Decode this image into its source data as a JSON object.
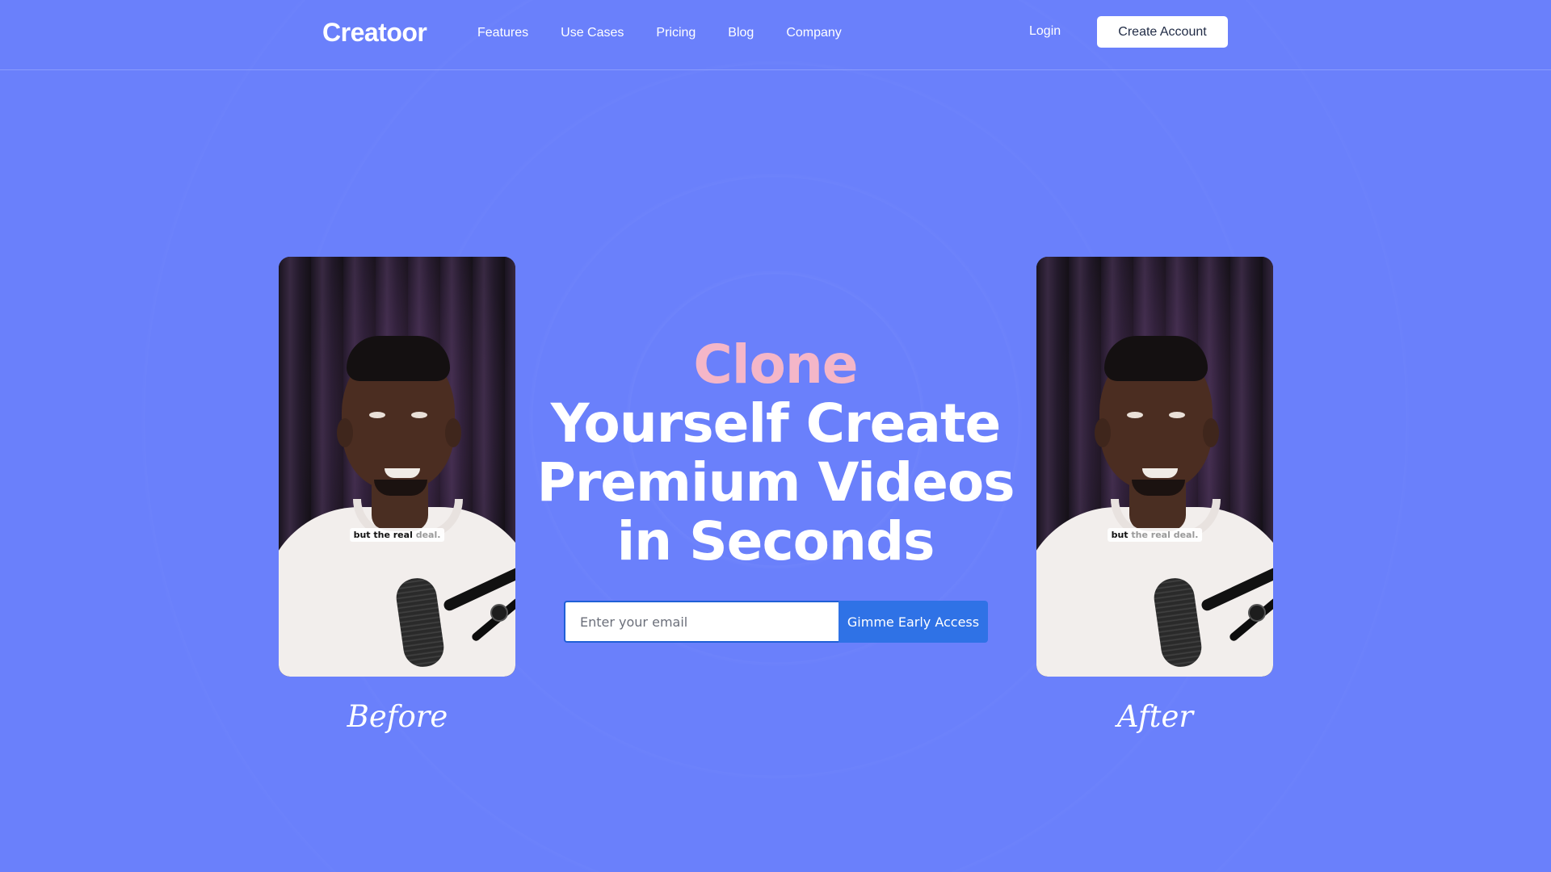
{
  "header": {
    "logo": "Creatoor",
    "nav": [
      "Features",
      "Use Cases",
      "Pricing",
      "Blog",
      "Company"
    ],
    "login_label": "Login",
    "create_account_label": "Create Account"
  },
  "hero": {
    "line1": "Clone",
    "line2": "Yourself Create",
    "line3": "Premium Videos",
    "line4": "in Seconds",
    "accent_color": "#f4b6c8"
  },
  "signup": {
    "email_placeholder": "Enter your email",
    "submit_label": "Gimme Early Access"
  },
  "before_card": {
    "caption_strong": "but the real",
    "caption_dim": "deal.",
    "label": "Before"
  },
  "after_card": {
    "caption_strong": "but",
    "caption_dim": "the real deal.",
    "label": "After"
  },
  "colors": {
    "background": "#6a80fb",
    "button_primary": "#2f72e6"
  }
}
